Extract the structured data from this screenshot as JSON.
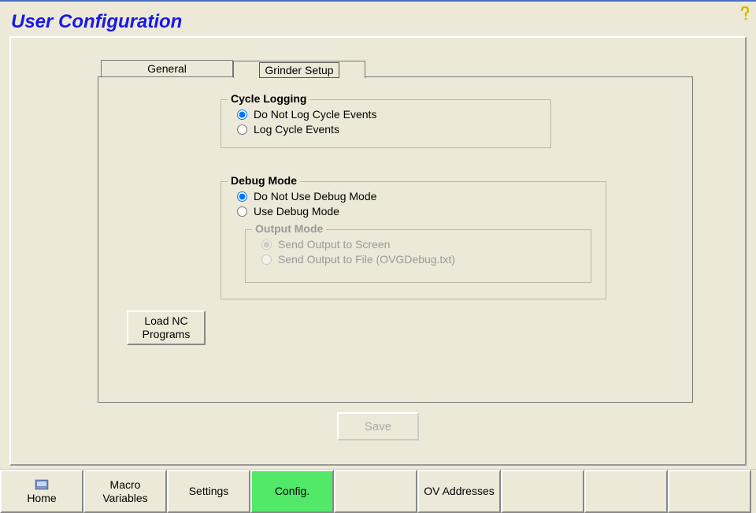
{
  "title": "User Configuration",
  "tabs": {
    "general": "General",
    "grinder_setup": "Grinder Setup"
  },
  "cycle_logging": {
    "legend": "Cycle Logging",
    "opt_no_log": "Do Not Log Cycle Events",
    "opt_log": "Log Cycle Events"
  },
  "debug_mode": {
    "legend": "Debug Mode",
    "opt_no_debug": "Do Not Use Debug Mode",
    "opt_debug": "Use Debug Mode"
  },
  "output_mode": {
    "legend": "Output Mode",
    "opt_screen": "Send Output to Screen",
    "opt_file": "Send Output to File (OVGDebug.txt)"
  },
  "buttons": {
    "load_nc": "Load NC Programs",
    "save": "Save"
  },
  "nav": {
    "home": "Home",
    "macro": "Macro Variables",
    "settings": "Settings",
    "config": "Config.",
    "ov_addresses": "OV Addresses"
  }
}
